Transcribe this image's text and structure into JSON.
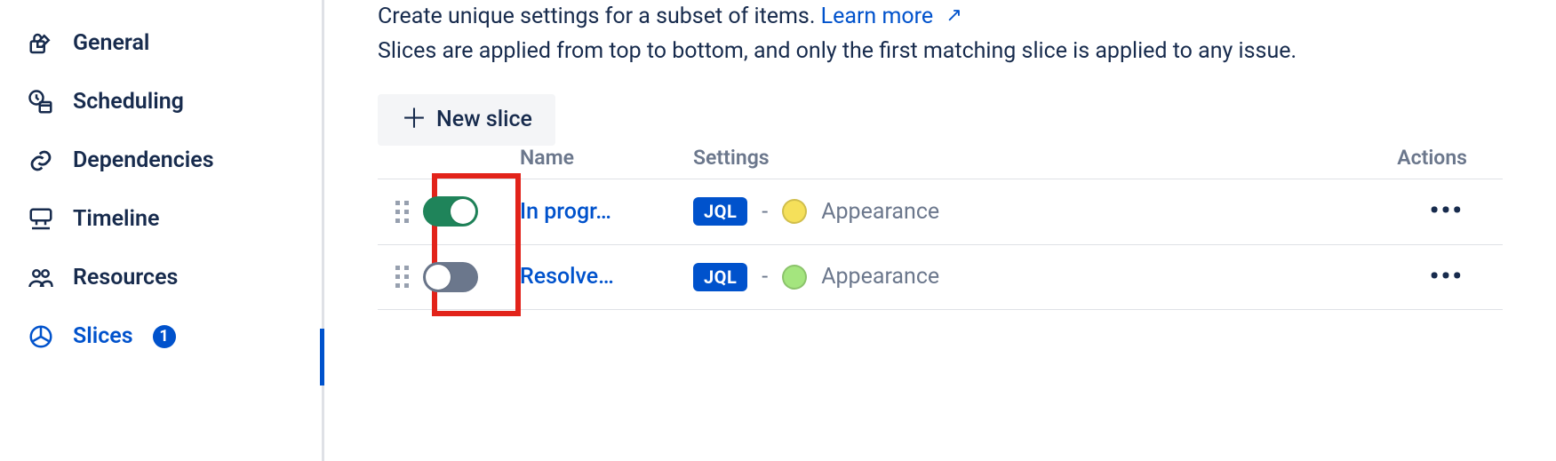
{
  "sidebar": {
    "items": [
      {
        "label": "General"
      },
      {
        "label": "Scheduling"
      },
      {
        "label": "Dependencies"
      },
      {
        "label": "Timeline"
      },
      {
        "label": "Resources"
      },
      {
        "label": "Slices",
        "active": true,
        "count": "1"
      }
    ]
  },
  "description": {
    "line1": "Create unique settings for a subset of items.",
    "learn_more": "Learn more",
    "line2": "Slices are applied from top to bottom, and only the first matching slice is applied to any issue."
  },
  "toolbar": {
    "new_slice_label": "New slice"
  },
  "table": {
    "headers": {
      "name": "Name",
      "settings": "Settings",
      "actions": "Actions"
    },
    "jql_label": "JQL",
    "appearance_label": "Appearance",
    "rows": [
      {
        "enabled": true,
        "name": "In progr…",
        "color": "#f5e05a"
      },
      {
        "enabled": false,
        "name": "Resolve…",
        "color": "#a4e57e"
      }
    ]
  }
}
